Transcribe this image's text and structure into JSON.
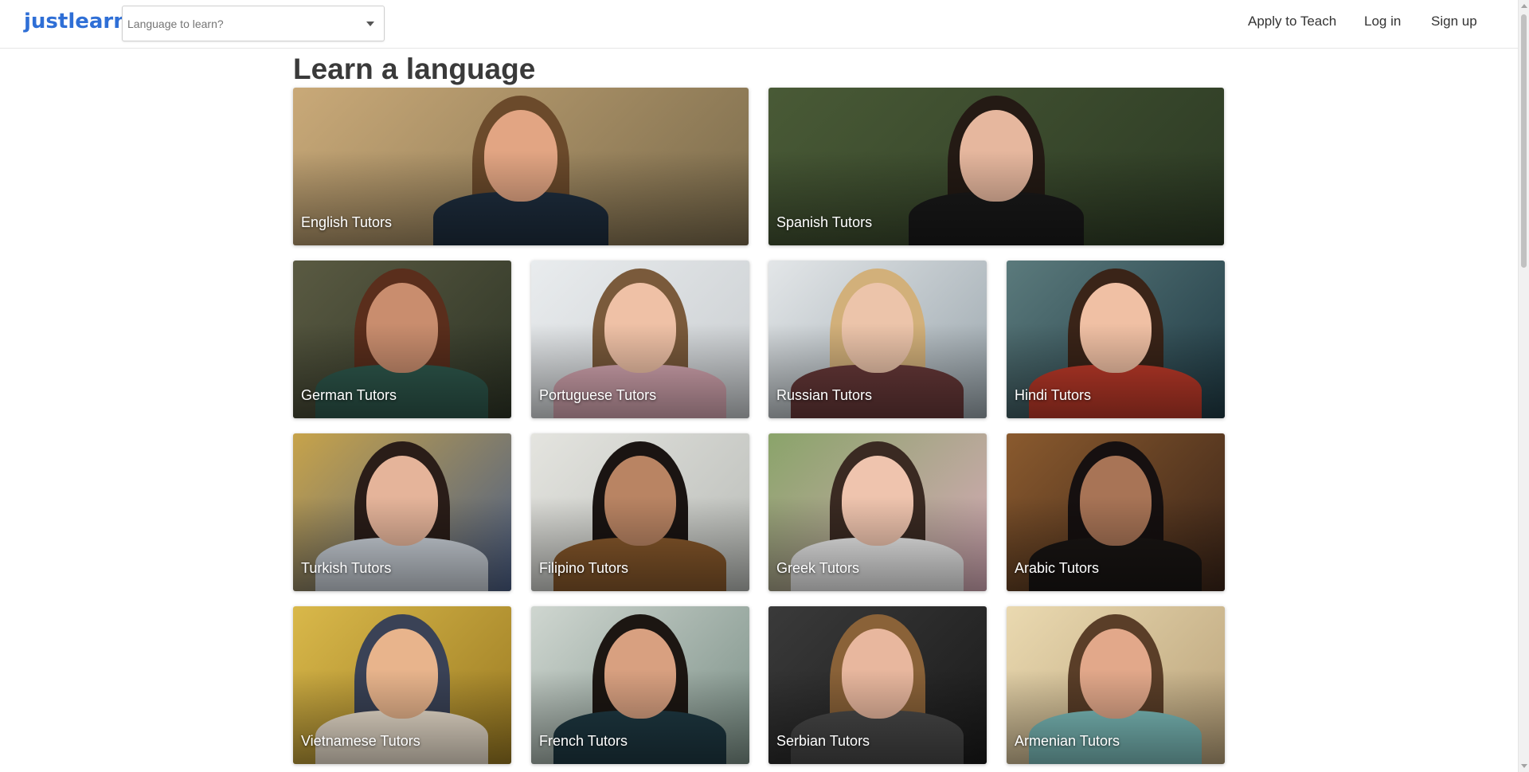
{
  "header": {
    "logo": "justlearn",
    "search_placeholder": "Language to learn?",
    "nav": {
      "apply": "Apply to Teach",
      "login": "Log in",
      "signup": "Sign up"
    }
  },
  "main": {
    "title": "Learn a language",
    "cards": [
      {
        "label": "English Tutors",
        "bg": "#7a6b4c",
        "bg2": "#c9a978",
        "skin": "#e2a583",
        "hair": "#6b4a2b",
        "cloth": "#1f2f40"
      },
      {
        "label": "Spanish Tutors",
        "bg": "#2c3a24",
        "bg2": "#495a36",
        "skin": "#e6b79e",
        "hair": "#241a14",
        "cloth": "#1a1a1a"
      },
      {
        "label": "German Tutors",
        "bg": "#2e3526",
        "bg2": "#5a5a42",
        "skin": "#c98d6e",
        "hair": "#5a2e1c",
        "cloth": "#2f5a4e"
      },
      {
        "label": "Portuguese Tutors",
        "bg": "#c9cdd0",
        "bg2": "#e9ecee",
        "skin": "#efc1a6",
        "hair": "#7a5a3b",
        "cloth": "#d9a9b4"
      },
      {
        "label": "Russian Tutors",
        "bg": "#9aa6ad",
        "bg2": "#e3e6e8",
        "skin": "#ecc4aa",
        "hair": "#d2b07a",
        "cloth": "#6a3a3a"
      },
      {
        "label": "Hindi Tutors",
        "bg": "#1f3a44",
        "bg2": "#5b7a7c",
        "skin": "#f0c0a4",
        "hair": "#3a2418",
        "cloth": "#c23b2a"
      },
      {
        "label": "Turkish Tutors",
        "bg": "#4a5e86",
        "bg2": "#c7a34a",
        "skin": "#e5b49a",
        "hair": "#2a1d18",
        "cloth": "#cfd6de"
      },
      {
        "label": "Filipino Tutors",
        "bg": "#b9bcb8",
        "bg2": "#e4e4df",
        "skin": "#b98463",
        "hair": "#1a1412",
        "cloth": "#8a5a2c"
      },
      {
        "label": "Greek Tutors",
        "bg": "#d7aab8",
        "bg2": "#8aa46a",
        "skin": "#efc4ae",
        "hair": "#3a2a22",
        "cloth": "#f0f0f0"
      },
      {
        "label": "Arabic Tutors",
        "bg": "#3a2418",
        "bg2": "#8a5a2e",
        "skin": "#a87456",
        "hair": "#161010",
        "cloth": "#1a1614"
      },
      {
        "label": "Vietnamese Tutors",
        "bg": "#9a7a22",
        "bg2": "#d9b84a",
        "skin": "#e8b48c",
        "hair": "#3a4256",
        "cloth": "#f2e6d4"
      },
      {
        "label": "French Tutors",
        "bg": "#7a8f86",
        "bg2": "#cfd6d0",
        "skin": "#d8a080",
        "hair": "#1c1612",
        "cloth": "#1f3a44"
      },
      {
        "label": "Serbian Tutors",
        "bg": "#1a1a1a",
        "bg2": "#3a3a3a",
        "skin": "#e8b79e",
        "hair": "#8a6238",
        "cloth": "#4a4a4a"
      },
      {
        "label": "Armenian Tutors",
        "bg": "#b9a27a",
        "bg2": "#ead9b0",
        "skin": "#e2a88a",
        "hair": "#5a3e28",
        "cloth": "#7fc2c0"
      }
    ]
  }
}
